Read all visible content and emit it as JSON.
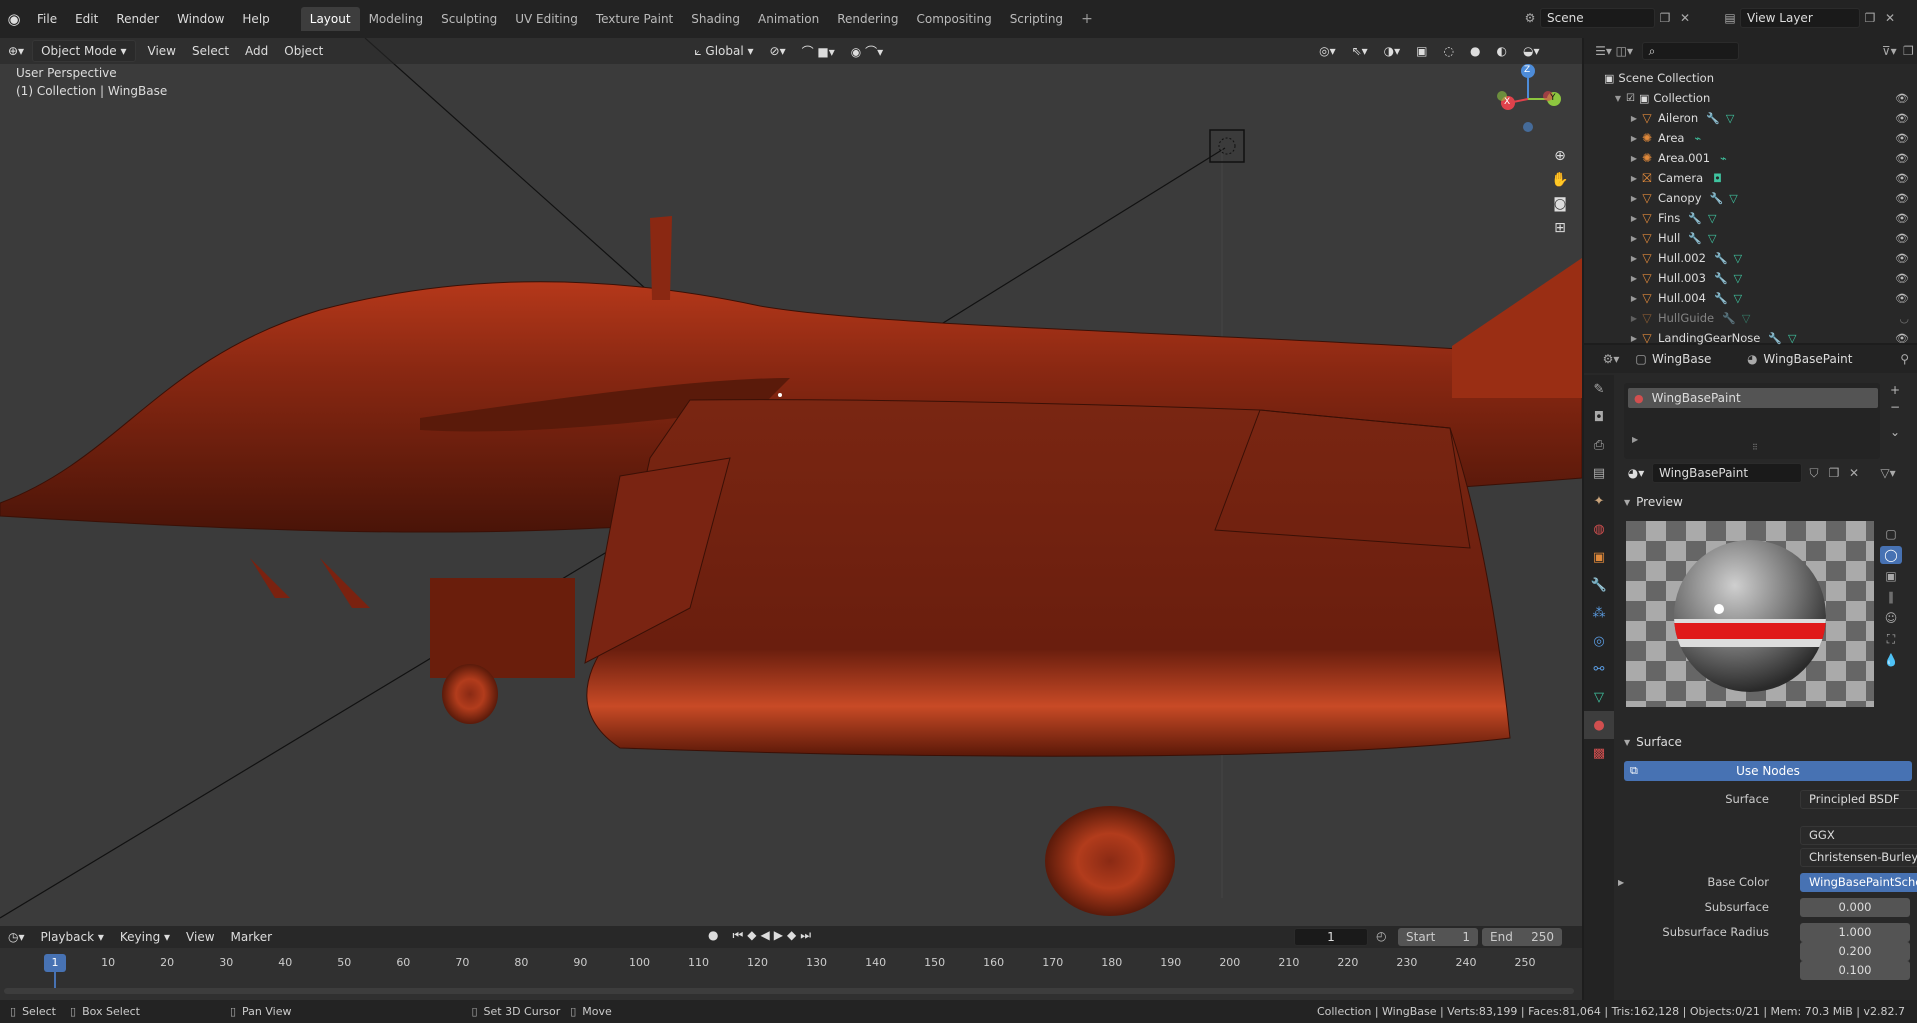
{
  "topbar": {
    "menus": [
      "File",
      "Edit",
      "Render",
      "Window",
      "Help"
    ],
    "workspaces": [
      "Layout",
      "Modeling",
      "Sculpting",
      "UV Editing",
      "Texture Paint",
      "Shading",
      "Animation",
      "Rendering",
      "Compositing",
      "Scripting"
    ],
    "active_workspace": "Layout",
    "scene": "Scene",
    "view_layer": "View Layer"
  },
  "viewport": {
    "mode": "Object Mode",
    "menus": [
      "View",
      "Select",
      "Add",
      "Object"
    ],
    "orientation": "Global",
    "overlay_title": "User Perspective",
    "overlay_subtitle": "(1) Collection | WingBase",
    "gizmo_labels": {
      "z": "Z",
      "y": "Y",
      "x": "X"
    }
  },
  "outliner": {
    "scene_collection": "Scene Collection",
    "collection": "Collection",
    "items": [
      {
        "name": "Aileron",
        "type": "mesh"
      },
      {
        "name": "Area",
        "type": "light"
      },
      {
        "name": "Area.001",
        "type": "light"
      },
      {
        "name": "Camera",
        "type": "camera"
      },
      {
        "name": "Canopy",
        "type": "mesh"
      },
      {
        "name": "Fins",
        "type": "mesh"
      },
      {
        "name": "Hull",
        "type": "mesh"
      },
      {
        "name": "Hull.002",
        "type": "mesh"
      },
      {
        "name": "Hull.003",
        "type": "mesh"
      },
      {
        "name": "Hull.004",
        "type": "mesh"
      },
      {
        "name": "HullGuide",
        "type": "mesh"
      },
      {
        "name": "LandingGearNose",
        "type": "mesh"
      }
    ]
  },
  "properties": {
    "object": "WingBase",
    "material": "WingBasePaint",
    "slot": "WingBasePaint",
    "datablock": "WingBasePaint",
    "preview_label": "Preview",
    "surface_section": "Surface",
    "use_nodes": "Use Nodes",
    "surface_label": "Surface",
    "surface_value": "Principled BSDF",
    "distribution": "GGX",
    "subsurface_method": "Christensen-Burley",
    "base_color_label": "Base Color",
    "base_color_value": "WingBasePaintSche...",
    "subsurface_label": "Subsurface",
    "subsurface_value": "0.000",
    "subsurface_radius_label": "Subsurface Radius",
    "subsurface_radius": [
      "1.000",
      "0.200",
      "0.100"
    ]
  },
  "timeline": {
    "menus": [
      "Playback",
      "Keying",
      "View",
      "Marker"
    ],
    "current_frame": "1",
    "start_label": "Start",
    "start": "1",
    "end_label": "End",
    "end": "250",
    "ticks": [
      "1",
      "10",
      "20",
      "30",
      "40",
      "50",
      "60",
      "70",
      "80",
      "90",
      "100",
      "110",
      "120",
      "130",
      "140",
      "150",
      "160",
      "170",
      "180",
      "190",
      "200",
      "210",
      "220",
      "230",
      "240",
      "250"
    ]
  },
  "statusbar": {
    "select": "Select",
    "box_select": "Box Select",
    "pan_view": "Pan View",
    "set_cursor": "Set 3D Cursor",
    "move": "Move",
    "stats": "Collection | WingBase | Verts:83,199 | Faces:81,064 | Tris:162,128 | Objects:0/21 | Mem: 70.3 MiB | v2.82.7"
  },
  "colors": {
    "accent": "#4772b3",
    "aircraft": "#8a2a14",
    "viewport_bg": "#3b3b3b"
  }
}
